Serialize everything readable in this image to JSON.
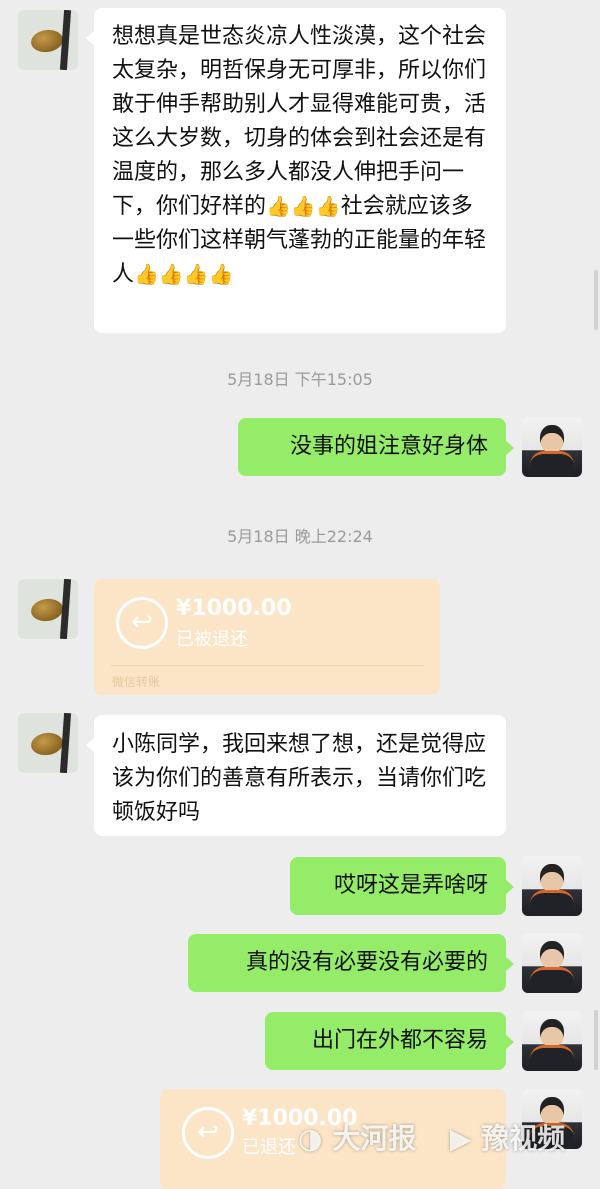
{
  "messages": {
    "m1": "想想真是世态炎凉人性淡漠，这个社会太复杂，明哲保身无可厚非，所以你们敢于伸手帮助别人才显得难能可贵，活这么大岁数，切身的体会到社会还是有温度的，那么多人都没人伸把手问一下，你们好样的",
    "m1_tail": "社会就应该多一些你们这样朝气蓬勃的正能量的年轻人",
    "m2": "没事的姐注意好身体",
    "m3": "小陈同学，我回来想了想，还是觉得应该为你们的善意有所表示，当请你们吃顿饭好吗",
    "m4": "哎呀这是弄啥呀",
    "m5": "真的没有必要没有必要的",
    "m6": "出门在外都不容易"
  },
  "timestamps": {
    "t1": "5月18日 下午15:05",
    "t2": "5月18日 晚上22:24"
  },
  "transfers": {
    "tr1": {
      "amount": "¥1000.00",
      "status": "已被退还",
      "label": "微信转账"
    },
    "tr2": {
      "amount": "¥1000.00",
      "status": "已退还"
    }
  },
  "emoji": {
    "thumbs_up": "👍"
  },
  "watermarks": {
    "left": "大河报",
    "right": "豫视频"
  },
  "colors": {
    "incoming": "#ffffff",
    "outgoing": "#95ec69",
    "transfer": "#fbe5c6",
    "background": "#ededed"
  }
}
